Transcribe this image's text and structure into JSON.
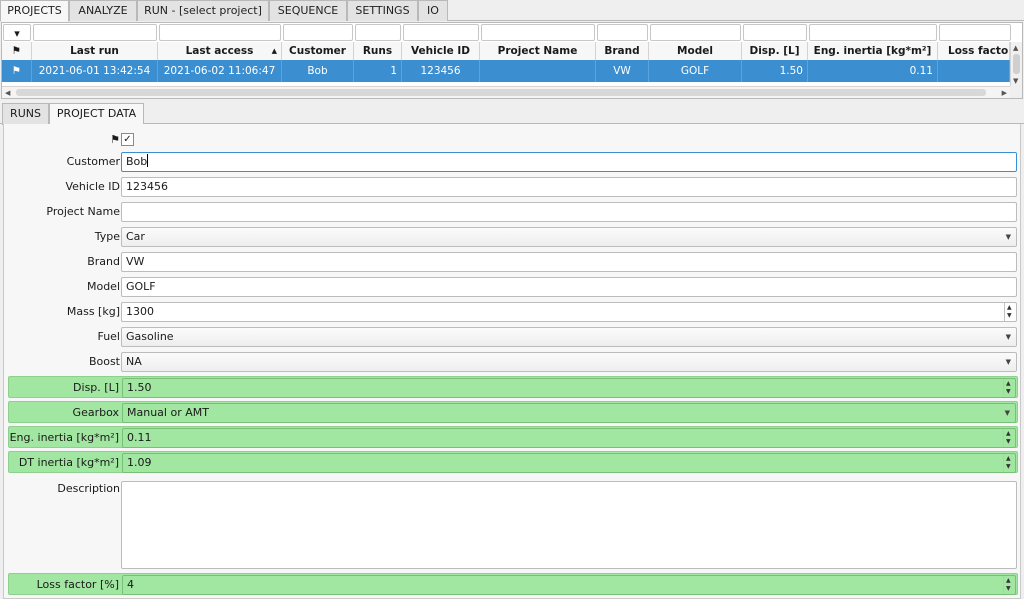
{
  "top_tabs": [
    {
      "label": "PROJECTS",
      "active": true
    },
    {
      "label": "ANALYZE",
      "active": false
    },
    {
      "label": "RUN - [select project]",
      "active": false
    },
    {
      "label": "SEQUENCE",
      "active": false
    },
    {
      "label": "SETTINGS",
      "active": false
    },
    {
      "label": "IO",
      "active": false
    }
  ],
  "grid": {
    "sort_indicator": "▲",
    "filter_dropdown_icon": "▾",
    "flag_icon": "⚑",
    "columns": [
      "⚑",
      "Last run",
      "Last access",
      "Customer",
      "Runs",
      "Vehicle ID",
      "Project Name",
      "Brand",
      "Model",
      "Disp. [L]",
      "Eng. inertia [kg*m²]",
      "Loss factor ["
    ],
    "rows": [
      [
        "⚑",
        "2021-06-01 13:42:54",
        "2021-06-02 11:06:47",
        "Bob",
        "1",
        "123456",
        "",
        "VW",
        "GOLF",
        "1.50",
        "0.11",
        ""
      ]
    ]
  },
  "lower_tabs": [
    {
      "label": "RUNS",
      "active": false
    },
    {
      "label": "PROJECT DATA",
      "active": true
    }
  ],
  "form": {
    "flag_label": "⚑",
    "flag_checked": "✓",
    "customer_label": "Customer",
    "customer_value": "Bob",
    "vehicle_id_label": "Vehicle ID",
    "vehicle_id_value": "123456",
    "project_name_label": "Project Name",
    "project_name_value": "",
    "type_label": "Type",
    "type_value": "Car",
    "brand_label": "Brand",
    "brand_value": "VW",
    "model_label": "Model",
    "model_value": "GOLF",
    "mass_label": "Mass [kg]",
    "mass_value": "1300",
    "fuel_label": "Fuel",
    "fuel_value": "Gasoline",
    "boost_label": "Boost",
    "boost_value": "NA",
    "disp_label": "Disp. [L]",
    "disp_value": "1.50",
    "gearbox_label": "Gearbox",
    "gearbox_value": "Manual or AMT",
    "eng_inertia_label": "Eng. inertia [kg*m²]",
    "eng_inertia_value": "0.11",
    "dt_inertia_label": "DT inertia [kg*m²]",
    "dt_inertia_value": "1.09",
    "description_label": "Description",
    "description_value": "",
    "loss_factor_label": "Loss factor [%]",
    "loss_factor_value": "4"
  },
  "colors": {
    "selection": "#3b8fd1",
    "highlight_green": "#a1e6a1"
  }
}
